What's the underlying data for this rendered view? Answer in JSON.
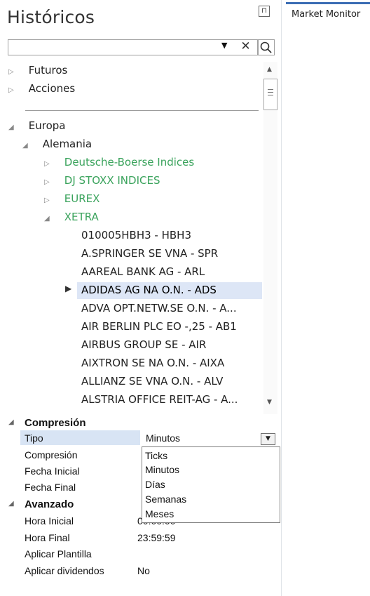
{
  "panel": {
    "title": "Históricos",
    "pin_icon": "pin-icon"
  },
  "market_monitor": {
    "title": "Market Monitor"
  },
  "search": {
    "value": "",
    "placeholder": "",
    "clear_symbol": "✕"
  },
  "tree": {
    "futuros": "Futuros",
    "acciones": "Acciones",
    "europa": "Europa",
    "alemania": "Alemania",
    "markets": [
      "Deutsche-Boerse Indices",
      "DJ STOXX INDICES",
      "EUREX",
      "XETRA"
    ],
    "symbols": [
      "010005HBH3 - HBH3",
      "A.SPRINGER SE VNA - SPR",
      "AAREAL BANK AG - ARL",
      "ADIDAS AG NA O.N. - ADS",
      "ADVA OPT.NETW.SE  O.N. - A...",
      "AIR BERLIN PLC  EO -,25 - AB1",
      "AIRBUS GROUP SE - AIR",
      "AIXTRON SE NA O.N. - AIXA",
      "ALLIANZ SE VNA O.N. - ALV",
      "ALSTRIA OFFICE REIT-AG - A..."
    ],
    "selected_symbol": "ADIDAS AG NA O.N. - ADS"
  },
  "properties": {
    "compresion_header": "Compresión",
    "tipo_label": "Tipo",
    "tipo_value": "Minutos",
    "compresion_label": "Compresión",
    "fecha_inicial_label": "Fecha Inicial",
    "fecha_final_label": "Fecha Final",
    "avanzado_header": "Avanzado",
    "hora_inicial_label": "Hora Inicial",
    "hora_inicial_value": "00:00:00",
    "hora_final_label": "Hora Final",
    "hora_final_value": "23:59:59",
    "aplicar_plantilla_label": "Aplicar Plantilla",
    "aplicar_dividendos_label": "Aplicar dividendos",
    "aplicar_dividendos_value": "No"
  },
  "tipo_dropdown": {
    "options": [
      "Ticks",
      "Minutos",
      "Días",
      "Semanas",
      "Meses"
    ]
  },
  "colors": {
    "accent": "#3b6db4",
    "market_green": "#3aa35c",
    "selection": "#dde6f6"
  }
}
